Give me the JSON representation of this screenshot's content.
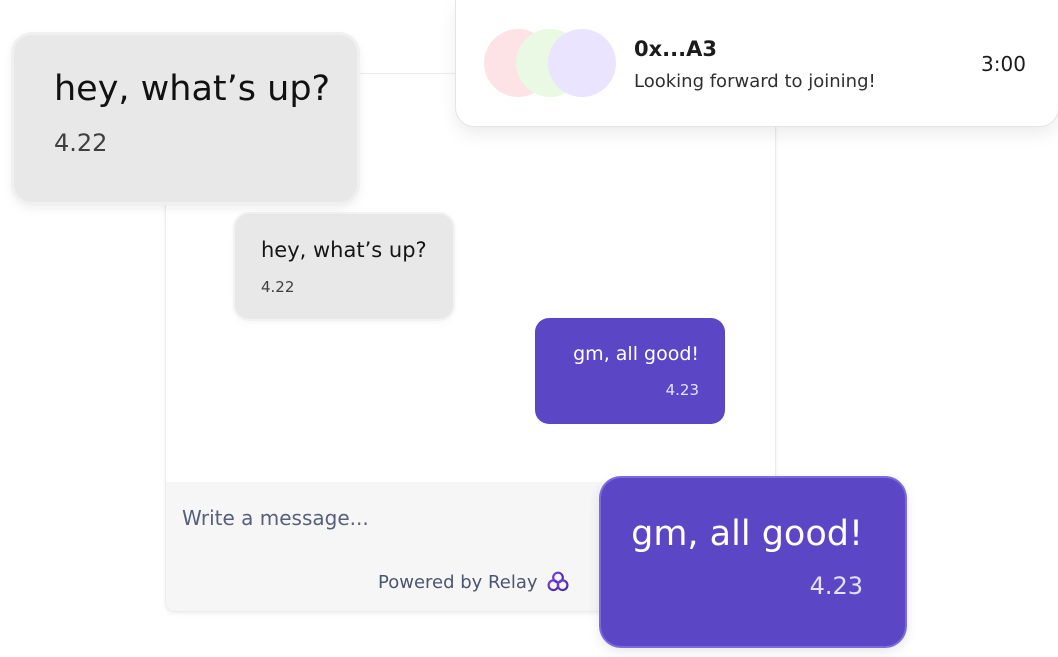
{
  "chat": {
    "composer": {
      "placeholder": "Write a message..."
    },
    "footer": {
      "powered_by": "Powered by Relay",
      "logo_icon": "relay-logo-icon"
    },
    "messages": [
      {
        "direction": "incoming",
        "text": "hey, what’s up?",
        "time": "4.22"
      },
      {
        "direction": "outgoing",
        "text": "gm, all good!",
        "time": "4.23"
      }
    ]
  },
  "highlights": {
    "incoming": {
      "text": "hey, what’s up?",
      "time": "4.22"
    },
    "outgoing": {
      "text": "gm, all good!",
      "time": "4.23"
    }
  },
  "notification": {
    "title": "0x...A3",
    "preview": "Looking forward to joining!",
    "time": "3:00",
    "avatar_colors": [
      "#fde3e5",
      "#e9f9e4",
      "#eae4ff"
    ]
  },
  "colors": {
    "accent": "#5b46c5",
    "incoming_bubble": "#e8e8e8",
    "composer_background": "#f6f6f6"
  }
}
